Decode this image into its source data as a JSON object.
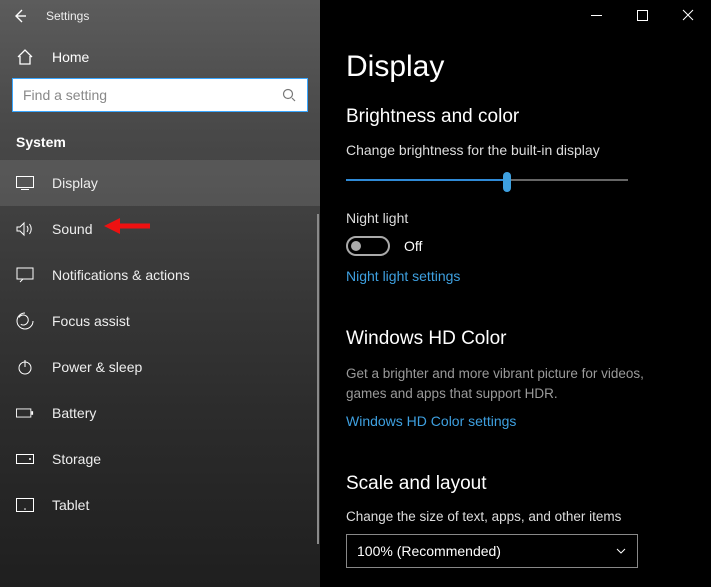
{
  "app": {
    "title": "Settings"
  },
  "home": {
    "label": "Home"
  },
  "search": {
    "placeholder": "Find a setting"
  },
  "section": {
    "label": "System"
  },
  "nav": {
    "items": [
      {
        "label": "Display"
      },
      {
        "label": "Sound"
      },
      {
        "label": "Notifications & actions"
      },
      {
        "label": "Focus assist"
      },
      {
        "label": "Power & sleep"
      },
      {
        "label": "Battery"
      },
      {
        "label": "Storage"
      },
      {
        "label": "Tablet"
      }
    ]
  },
  "page": {
    "title": "Display"
  },
  "brightness": {
    "heading": "Brightness and color",
    "label": "Change brightness for the built-in display",
    "value_percent": 57
  },
  "nightlight": {
    "label": "Night light",
    "state": "Off",
    "link": "Night light settings"
  },
  "hdcolor": {
    "heading": "Windows HD Color",
    "descr": "Get a brighter and more vibrant picture for videos, games and apps that support HDR.",
    "link": "Windows HD Color settings"
  },
  "scale": {
    "heading": "Scale and layout",
    "label": "Change the size of text, apps, and other items",
    "selected": "100% (Recommended)"
  }
}
